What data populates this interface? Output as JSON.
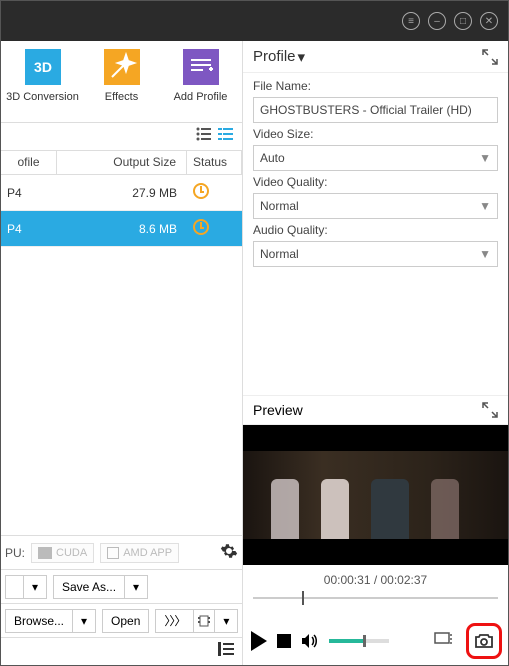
{
  "titlebar": {
    "menu_icon": "menu",
    "min_icon": "minimize",
    "max_icon": "maximize",
    "close_icon": "close"
  },
  "ribbon": {
    "conv3d": "3D Conversion",
    "effects": "Effects",
    "addprofile": "Add Profile"
  },
  "table": {
    "head": {
      "file": "ofile",
      "size": "Output Size",
      "status": "Status"
    },
    "rows": [
      {
        "file": "P4",
        "size": "27.9 MB",
        "selected": false
      },
      {
        "file": "P4",
        "size": "8.6 MB",
        "selected": true
      }
    ]
  },
  "gpu": {
    "label": "PU:",
    "cuda": "CUDA",
    "amd": "AMD APP"
  },
  "buttons": {
    "saveas": "Save As...",
    "browse": "Browse...",
    "open": "Open",
    "arrows": "〉〉〉"
  },
  "profile": {
    "title": "Profile",
    "filename_label": "File Name:",
    "filename_value": "GHOSTBUSTERS - Official Trailer (HD)",
    "videosize_label": "Video Size:",
    "videosize_value": "Auto",
    "videoquality_label": "Video Quality:",
    "videoquality_value": "Normal",
    "audioquality_label": "Audio Quality:",
    "audioquality_value": "Normal"
  },
  "preview": {
    "title": "Preview",
    "time": "00:00:31 / 00:02:37"
  }
}
